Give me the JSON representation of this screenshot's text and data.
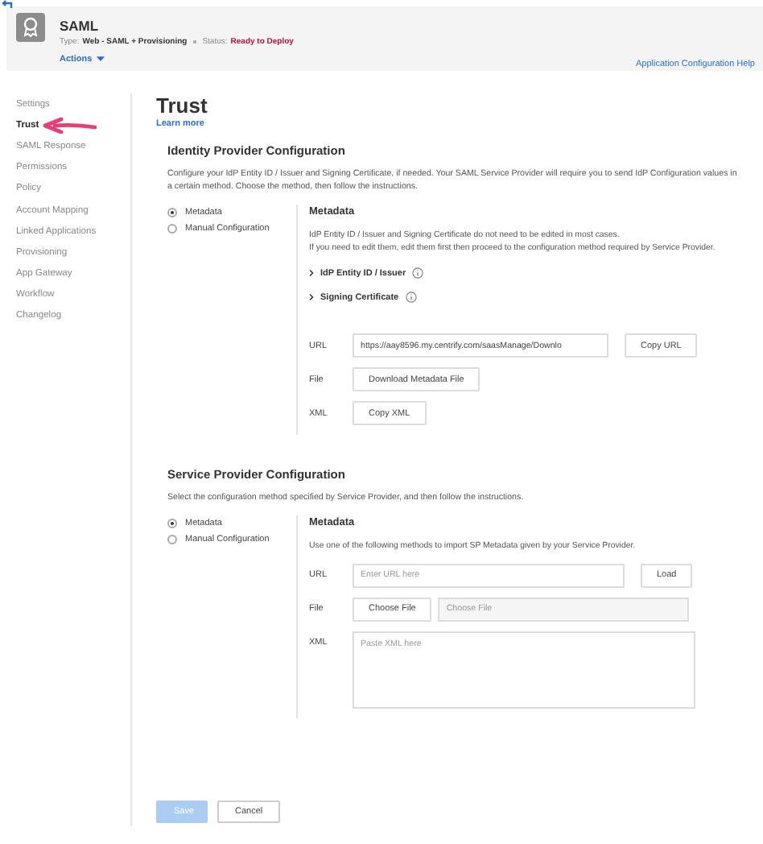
{
  "app": {
    "name": "SAML",
    "type_label": "Type:",
    "type": "Web - SAML + Provisioning",
    "status_label": "Status:",
    "status": "Ready to Deploy",
    "actions": "Actions",
    "help": "Application Configuration Help"
  },
  "sidebar": {
    "items": [
      {
        "label": "Settings",
        "selected": false
      },
      {
        "label": "Trust",
        "selected": true
      },
      {
        "label": "SAML Response",
        "selected": false
      },
      {
        "label": "Permissions",
        "selected": false
      },
      {
        "label": "Policy",
        "selected": false
      },
      {
        "label": "Account Mapping",
        "selected": false
      },
      {
        "label": "Linked Applications",
        "selected": false
      },
      {
        "label": "Provisioning",
        "selected": false
      },
      {
        "label": "App Gateway",
        "selected": false
      },
      {
        "label": "Workflow",
        "selected": false
      },
      {
        "label": "Changelog",
        "selected": false
      }
    ]
  },
  "page": {
    "title": "Trust",
    "learn_more": "Learn more"
  },
  "sections": [
    {
      "heading": "Identity Provider Configuration",
      "description": "Configure your IdP Entity ID / Issuer and Signing Certificate, if needed. Your SAML Service Provider will require you to send IdP Configuration values in a certain method. Choose the method, then follow the instructions.",
      "methods": [
        {
          "label": "Metadata",
          "selected": true
        },
        {
          "label": "Manual Configuration",
          "selected": false
        }
      ],
      "panel": {
        "title": "Metadata",
        "notes": [
          "IdP Entity ID / Issuer and Signing Certificate do not need to be edited in most cases.",
          "If you need to edit them, edit them first then proceed to the configuration method required by Service Provider."
        ],
        "expanders": [
          {
            "label": "IdP Entity ID / Issuer",
            "expanded": false
          },
          {
            "label": "Signing Certificate",
            "expanded": false
          }
        ],
        "rows": [
          {
            "label": "URL",
            "kind": "field-button",
            "value": "https://aay8596.my.centrify.com/saasManage/Downlo",
            "button": "Copy URL"
          },
          {
            "label": "File",
            "kind": "button",
            "button": "Download Metadata File"
          },
          {
            "label": "XML",
            "kind": "button",
            "button": "Copy XML"
          }
        ]
      }
    },
    {
      "heading": "Service Provider Configuration",
      "description": "Select the configuration method specified by Service Provider, and then follow the instructions.",
      "methods": [
        {
          "label": "Metadata",
          "selected": true
        },
        {
          "label": "Manual Configuration",
          "selected": false
        }
      ],
      "panel": {
        "title": "Metadata",
        "notes": [
          "Use one of the following methods to import SP Metadata given by your Service Provider."
        ],
        "rows": [
          {
            "label": "URL",
            "kind": "field-button",
            "placeholder": "Enter URL here",
            "button": "Load"
          },
          {
            "label": "File",
            "kind": "button-field",
            "button": "Choose File",
            "placeholder": "Choose File"
          },
          {
            "label": "XML",
            "kind": "textarea",
            "placeholder": "Paste XML here"
          }
        ]
      }
    }
  ],
  "buttons": [
    {
      "label": "Save",
      "disabled": true
    },
    {
      "label": "Cancel",
      "disabled": false
    }
  ]
}
